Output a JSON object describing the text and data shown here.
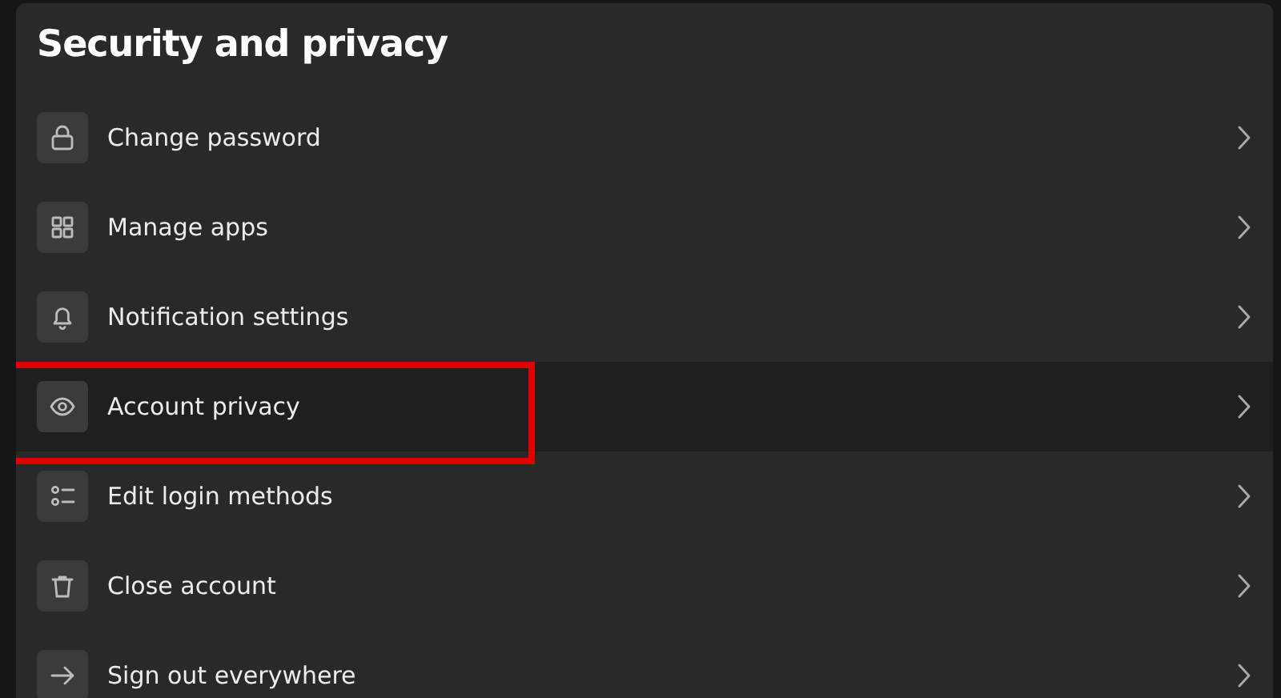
{
  "title": "Security and privacy",
  "items": [
    {
      "label": "Change password",
      "selected": false
    },
    {
      "label": "Manage apps",
      "selected": false
    },
    {
      "label": "Notification settings",
      "selected": false
    },
    {
      "label": "Account privacy",
      "selected": true
    },
    {
      "label": "Edit login methods",
      "selected": false
    },
    {
      "label": "Close account",
      "selected": false
    },
    {
      "label": "Sign out everywhere",
      "selected": false
    }
  ]
}
